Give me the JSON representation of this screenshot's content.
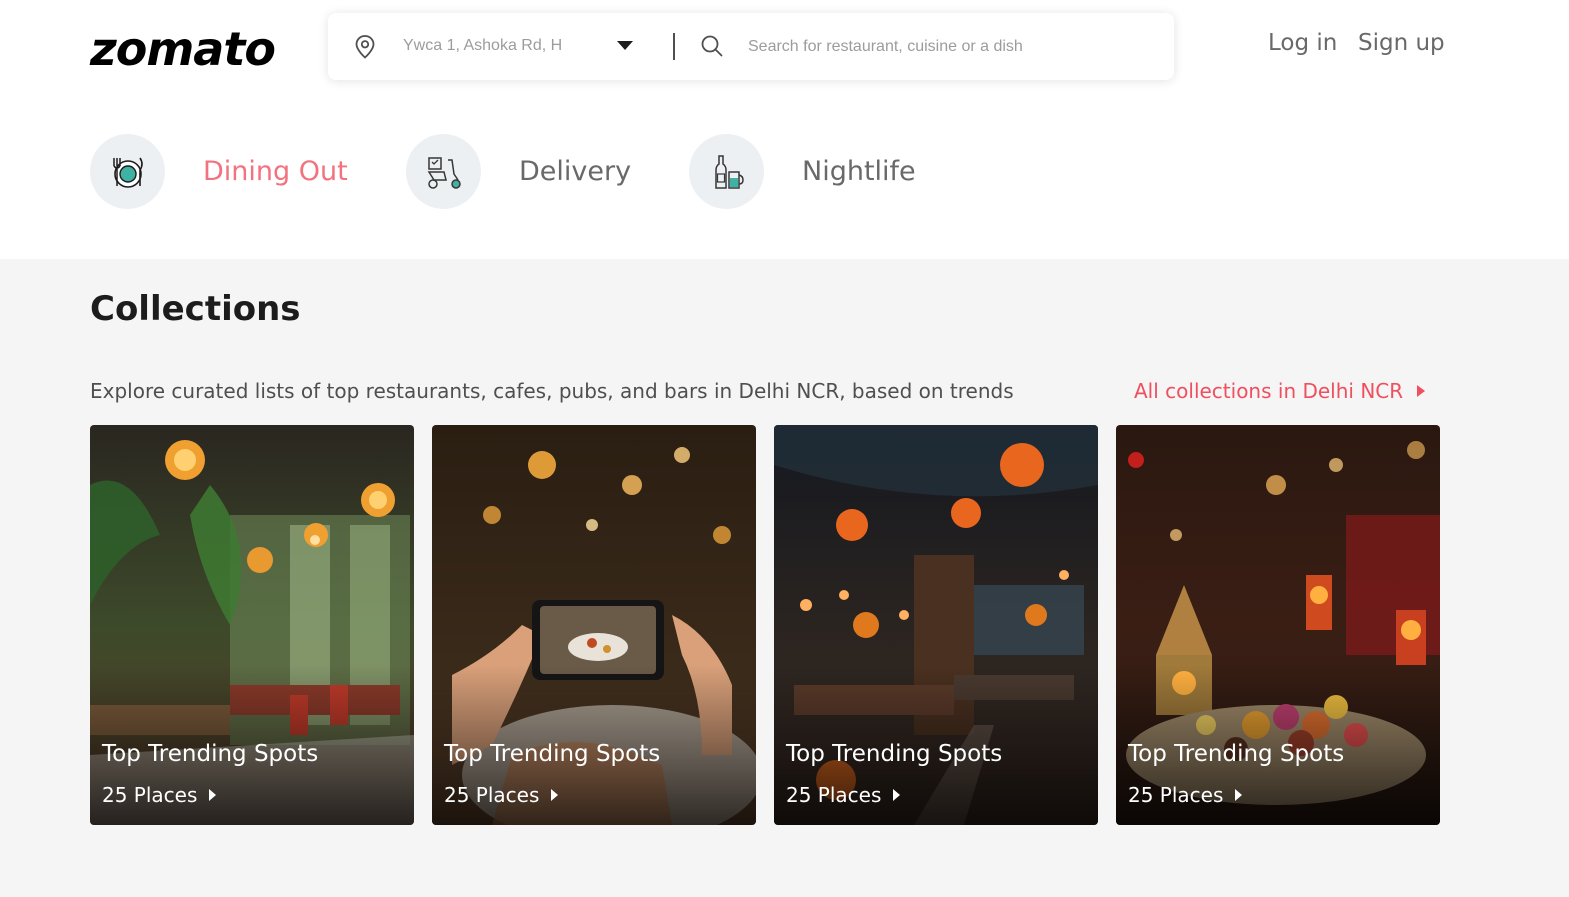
{
  "header": {
    "logo": "zomato",
    "location_value": "Ywca 1, Ashoka Rd, H",
    "search_placeholder": "Search for restaurant, cuisine or a dish",
    "login": "Log in",
    "signup": "Sign up",
    "icons": [
      "location-pin-icon",
      "caret-down-icon",
      "search-icon"
    ]
  },
  "tabs": [
    {
      "label": "Dining Out",
      "icon": "dining-icon",
      "active": true
    },
    {
      "label": "Delivery",
      "icon": "scooter-icon",
      "active": false
    },
    {
      "label": "Nightlife",
      "icon": "bottle-glass-icon",
      "active": false
    }
  ],
  "collections": {
    "title": "Collections",
    "description": "Explore curated lists of top restaurants, cafes, pubs, and bars in Delhi NCR, based on trends",
    "all_link": "All collections in Delhi NCR",
    "cards": [
      {
        "title": "Top Trending Spots",
        "places": "25 Places"
      },
      {
        "title": "Top Trending Spots",
        "places": "25 Places"
      },
      {
        "title": "Top Trending Spots",
        "places": "25 Places"
      },
      {
        "title": "Top Trending Spots",
        "places": "25 Places"
      }
    ]
  },
  "colors": {
    "accent": "#ef4f5f",
    "text_muted": "#696969",
    "section_bg": "#f5f5f5"
  }
}
